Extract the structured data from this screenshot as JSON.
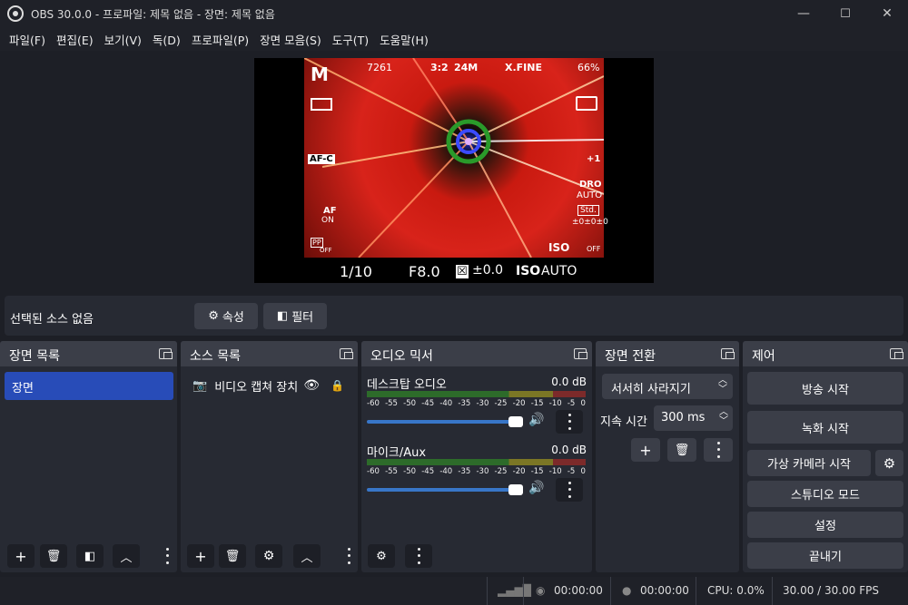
{
  "window": {
    "title": "OBS 30.0.0 - 프로파일: 제목 없음 - 장면: 제목 없음",
    "minimize": "—",
    "maximize": "☐",
    "close": "✕"
  },
  "menu": [
    "파일(F)",
    "편집(E)",
    "보기(V)",
    "독(D)",
    "프로파일(P)",
    "장면 모음(S)",
    "도구(T)",
    "도움말(H)"
  ],
  "camera_osd": {
    "mode": "M",
    "shots": "7261",
    "aspect": "3:2",
    "size": "24M",
    "quality": "X.FINE",
    "battery": "66%",
    "af": "AF-C",
    "dro": "DRO",
    "dro_val": "AUTO",
    "std": "Std.",
    "std_val": "±0±0±0",
    "af_on": "AF",
    "af_on2": "ON",
    "pp": "PP",
    "pp2": "OFF",
    "shutter": "1/10",
    "aperture": "F8.0",
    "ev": "±0.0",
    "iso_label": "ISO",
    "iso": "AUTO",
    "flash_comp": "+1",
    "off": "OFF"
  },
  "source_bar": {
    "label": "선택된 소스 없음",
    "properties": "속성",
    "filters": "필터"
  },
  "scenes": {
    "title": "장면 목록",
    "items": [
      "장면"
    ]
  },
  "sources": {
    "title": "소스 목록",
    "items": [
      "비디오 캡쳐 장치"
    ]
  },
  "mixer": {
    "title": "오디오 믹서",
    "channels": [
      {
        "name": "데스크탑 오디오",
        "db": "0.0 dB"
      },
      {
        "name": "마이크/Aux",
        "db": "0.0 dB"
      }
    ],
    "ticks": [
      "-60",
      "-55",
      "-50",
      "-45",
      "-40",
      "-35",
      "-30",
      "-25",
      "-20",
      "-15",
      "-10",
      "-5",
      "0"
    ]
  },
  "transitions": {
    "title": "장면 전환",
    "selected": "서서히 사라지기",
    "duration_label": "지속 시간",
    "duration": "300 ms"
  },
  "controls": {
    "title": "제어",
    "start_stream": "방송 시작",
    "start_record": "녹화 시작",
    "start_vcam": "가상 카메라 시작",
    "studio_mode": "스튜디오 모드",
    "settings": "설정",
    "exit": "끝내기"
  },
  "status": {
    "stream_time": "00:00:00",
    "record_time": "00:00:00",
    "cpu": "CPU: 0.0%",
    "fps": "30.00 / 30.00 FPS"
  }
}
